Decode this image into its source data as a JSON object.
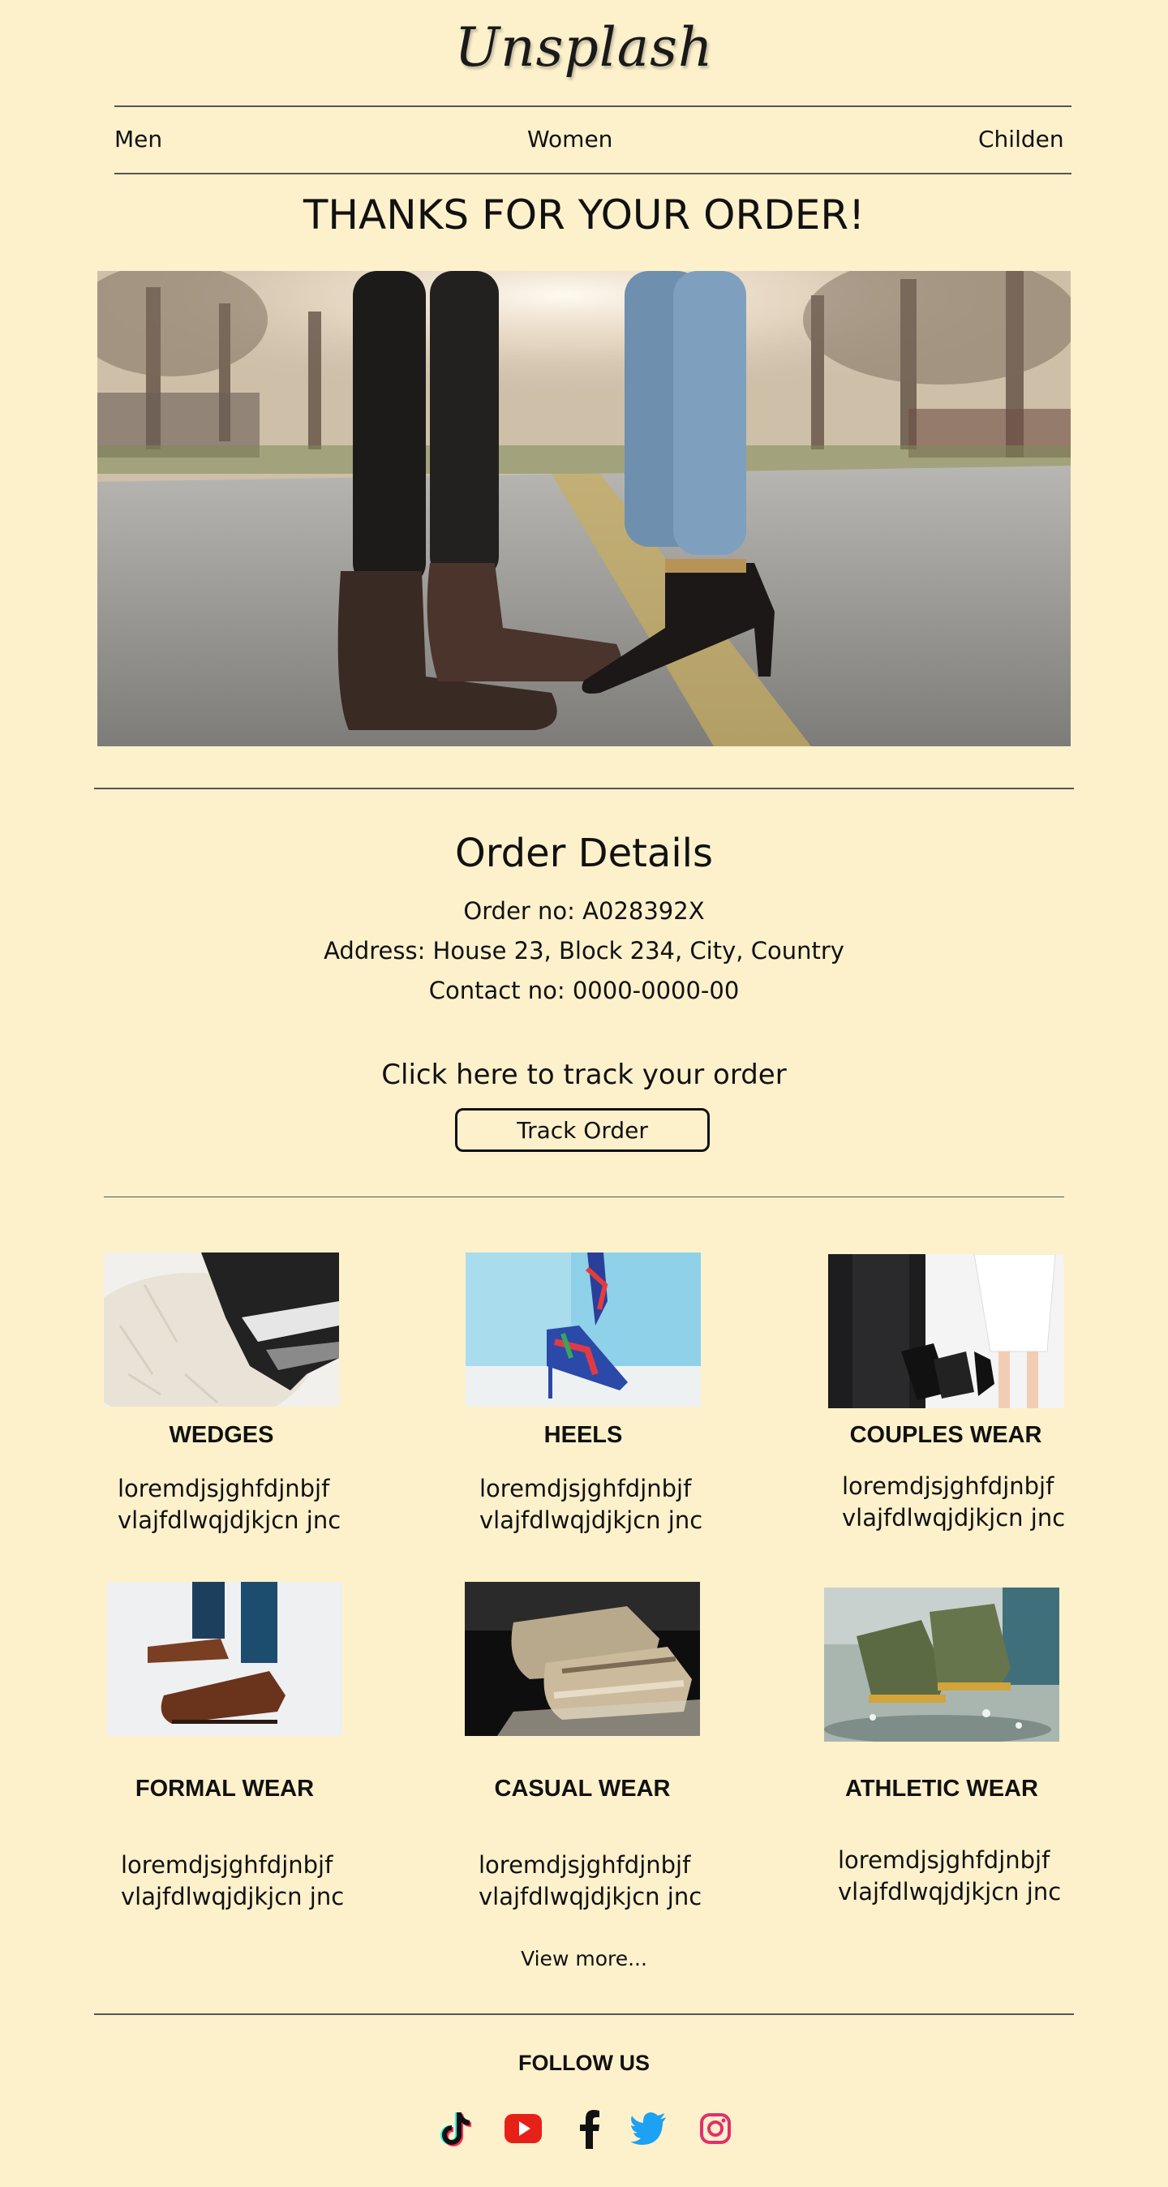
{
  "brand": {
    "logo_text": "Unsplash"
  },
  "nav": {
    "items": [
      "Men",
      "Women",
      "Childen"
    ]
  },
  "headline": "THANKS FOR YOUR ORDER!",
  "order": {
    "title": "Order Details",
    "order_no": "Order no: A028392X",
    "address": "Address: House 23, Block 234, City, Country",
    "contact": "Contact no: 0000-0000-00"
  },
  "tracking": {
    "prompt": "Click here to track your order",
    "button_label": "Track Order"
  },
  "products": [
    {
      "title": "WEDGES",
      "desc_line1": "loremdjsjghfdjnbjf",
      "desc_line2": "vlajfdlwqjdjkjcn jnc"
    },
    {
      "title": "HEELS",
      "desc_line1": "loremdjsjghfdjnbjf",
      "desc_line2": "vlajfdlwqjdjkjcn jnc"
    },
    {
      "title": "COUPLES WEAR",
      "desc_line1": "loremdjsjghfdjnbjf",
      "desc_line2": "vlajfdlwqjdjkjcn jnc"
    },
    {
      "title": "FORMAL WEAR",
      "desc_line1": "loremdjsjghfdjnbjf",
      "desc_line2": "vlajfdlwqjdjkjcn jnc"
    },
    {
      "title": "CASUAL WEAR",
      "desc_line1": "loremdjsjghfdjnbjf",
      "desc_line2": "vlajfdlwqjdjkjcn jnc"
    },
    {
      "title": "ATHLETIC WEAR",
      "desc_line1": "loremdjsjghfdjnbjf",
      "desc_line2": "vlajfdlwqjdjkjcn jnc"
    }
  ],
  "view_more": "View more...",
  "footer": {
    "follow_label": "FOLLOW US",
    "social": [
      {
        "icon": "tiktok-icon",
        "color": "#111111"
      },
      {
        "icon": "youtube-icon",
        "color": "#e62117"
      },
      {
        "icon": "facebook-icon",
        "color": "#111111"
      },
      {
        "icon": "twitter-icon",
        "color": "#1da1f2"
      },
      {
        "icon": "instagram-icon",
        "color": "#e1306c"
      }
    ]
  },
  "colors": {
    "background": "#fdf1cc",
    "text": "#111111",
    "rule": "#555555"
  }
}
